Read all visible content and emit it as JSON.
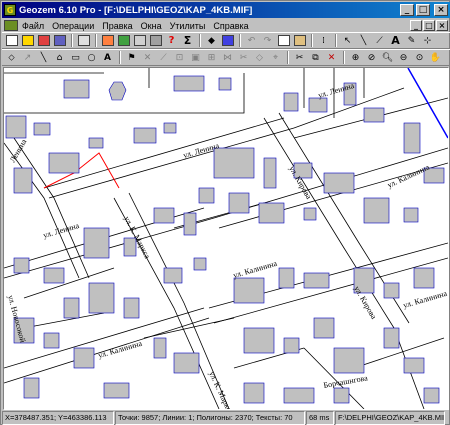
{
  "window": {
    "title": "Geozem 6.10 Pro - [F:\\DELPHI\\GEOZ\\KAP_4KB.MIF]",
    "app_icon_glyph": "G"
  },
  "menu": [
    "Файл",
    "Операции",
    "Правка",
    "Окна",
    "Утилиты",
    "Справка"
  ],
  "map": {
    "streets": [
      {
        "label": "ул. Ленина"
      },
      {
        "label": "ул. Ленина"
      },
      {
        "label": "ул. Ленина"
      },
      {
        "label": "Ленина"
      },
      {
        "label": "ул. Кирова"
      },
      {
        "label": "ул. Калинина"
      },
      {
        "label": "ул. Калинина"
      },
      {
        "label": "ул. К. Маркса"
      },
      {
        "label": "ул. Калинина"
      },
      {
        "label": "ул. Кирова"
      },
      {
        "label": "ул. Новосокой"
      },
      {
        "label": "ул. Калинина"
      },
      {
        "label": "ул. К. Маркса"
      },
      {
        "label": "Борчашнгова"
      }
    ],
    "colors": {
      "building_fill": "#c0c0c0",
      "building_stroke": "#0000c0",
      "line": "#000000",
      "red_line": "#ff0000",
      "blue_line": "#0000ff"
    }
  },
  "status": {
    "coords": "X=378487.351; Y=463386.113",
    "stats": "Точки: 9857; Линии: 1; Полигоны: 2370; Тексты: 70",
    "time": "68 ms",
    "path": "F:\\DELPHI\\GEOZ\\KAP_4KB.MIF"
  }
}
